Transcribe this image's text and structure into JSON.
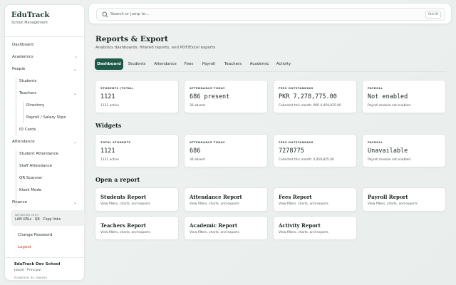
{
  "app": {
    "title": "EduTrack",
    "subtitle": "School Management"
  },
  "sidebar": {
    "items": [
      {
        "label": "Dashboard",
        "level": 0,
        "chevron": ""
      },
      {
        "label": "Academics",
        "level": 0,
        "chevron": "›"
      },
      {
        "label": "People",
        "level": 0,
        "chevron": "⌄"
      },
      {
        "label": "Students",
        "level": 1,
        "chevron": ""
      },
      {
        "label": "Teachers",
        "level": 1,
        "chevron": "⌄"
      },
      {
        "label": "Directory",
        "level": 2,
        "chevron": ""
      },
      {
        "label": "Payroll / Salary Slips",
        "level": 2,
        "chevron": ""
      },
      {
        "label": "ID Cards",
        "level": 1,
        "chevron": ""
      },
      {
        "label": "Attendance",
        "level": 0,
        "chevron": "⌄"
      },
      {
        "label": "Student Attendance",
        "level": 1,
        "chevron": ""
      },
      {
        "label": "Staff Attendance",
        "level": 1,
        "chevron": ""
      },
      {
        "label": "QR Scanner",
        "level": 1,
        "chevron": ""
      },
      {
        "label": "Kiosk Mode",
        "level": 1,
        "chevron": ""
      },
      {
        "label": "Finance",
        "level": 0,
        "chevron": "⌄"
      }
    ],
    "network": {
      "label": "NETWORK INFO",
      "value": "LAN URLs · QR · Copy links"
    },
    "change_password": "Change Password",
    "logout": "Logout",
    "school": "EduTrack Dev School",
    "user": "Jawad · Principal",
    "powered": "POWERED BY ONKIRO"
  },
  "search": {
    "placeholder": "Search or jump to…",
    "shortcut": "Ctrl+K"
  },
  "page": {
    "title": "Reports & Export",
    "subtitle": "Analytics dashboards, filtered reports, and PDF/Excel exports."
  },
  "tabs": [
    "Dashboard",
    "Students",
    "Attendance",
    "Fees",
    "Payroll",
    "Teachers",
    "Academic",
    "Activity"
  ],
  "tab_active": "Dashboard",
  "summary_cards": [
    {
      "label": "STUDENTS (TOTAL)",
      "value": "1121",
      "note": "1121 active"
    },
    {
      "label": "ATTENDANCE TODAY",
      "value": "686 present",
      "note": "36 absent"
    },
    {
      "label": "FEES OUTSTANDING",
      "value": "PKR 7,278,775.00",
      "note": "Collected this month: PKR 4,459,825.00"
    },
    {
      "label": "PAYROLL",
      "value": "Not enabled",
      "note": "Payroll module not enabled"
    }
  ],
  "widgets": {
    "title": "Widgets",
    "cards": [
      {
        "label": "TOTAL STUDENTS",
        "value": "1121",
        "note": "1121 active"
      },
      {
        "label": "ATTENDANCE TODAY",
        "value": "686",
        "note": "36 absent"
      },
      {
        "label": "FEES OUTSTANDING",
        "value": "7278775",
        "note": "Collected this month: 4,459,825.00"
      },
      {
        "label": "PAYROLL",
        "value": "Unavailable",
        "note": "Payroll module not enabled"
      }
    ]
  },
  "reports": {
    "title": "Open a report",
    "items": [
      {
        "title": "Students Report",
        "desc": "View filters, charts, and exports"
      },
      {
        "title": "Attendance Report",
        "desc": "View filters, charts, and exports"
      },
      {
        "title": "Fees Report",
        "desc": "View filters, charts, and exports"
      },
      {
        "title": "Payroll Report",
        "desc": "View filters, charts, and exports"
      },
      {
        "title": "Teachers Report",
        "desc": "View filters, charts, and exports"
      },
      {
        "title": "Academic Report",
        "desc": "View filters, charts, and exports"
      },
      {
        "title": "Activity Report",
        "desc": "View filters, charts, and exports"
      }
    ]
  },
  "colors": {
    "accent": "#1f5a48",
    "logout": "#c0392b"
  }
}
